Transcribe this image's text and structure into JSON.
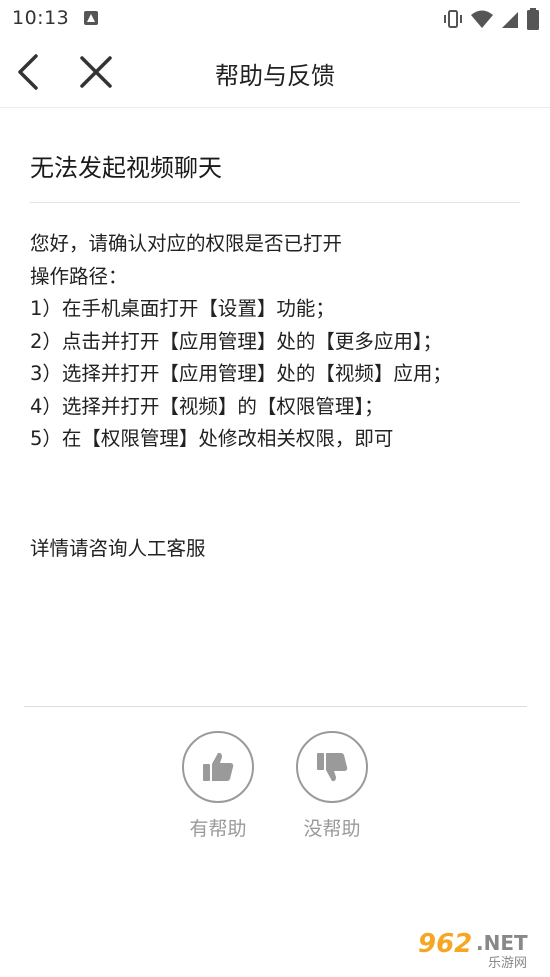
{
  "status_bar": {
    "time": "10:13",
    "icons": [
      "notification-a-icon",
      "vibrate-icon",
      "wifi-icon",
      "signal-icon",
      "battery-icon"
    ]
  },
  "nav": {
    "title": "帮助与反馈",
    "back_icon": "chevron-left-icon",
    "close_icon": "close-icon"
  },
  "article": {
    "title": "无法发起视频聊天",
    "lines": [
      "您好，请确认对应的权限是否已打开",
      "操作路径：",
      "1）在手机桌面打开【设置】功能；",
      "2）点击并打开【应用管理】处的【更多应用】；",
      "3）选择并打开【应用管理】处的【视频】应用；",
      "4）选择并打开【视频】的【权限管理】；",
      "5）在【权限管理】处修改相关权限，即可"
    ],
    "footer_note": "详情请咨询人工客服"
  },
  "feedback": {
    "helpful_label": "有帮助",
    "unhelpful_label": "没帮助",
    "helpful_icon": "thumbs-up-icon",
    "unhelpful_icon": "thumbs-down-icon"
  },
  "watermark": {
    "brand": "962.NET",
    "sub": "乐游网"
  },
  "colors": {
    "text": "#222222",
    "muted": "#9a9a9a",
    "divider": "#e4e4e4",
    "watermark_orange": "#f5a623"
  }
}
